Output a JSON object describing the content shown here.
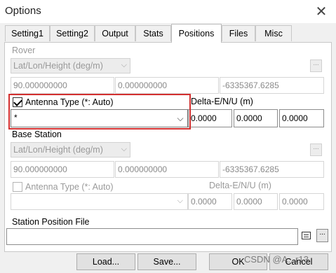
{
  "window": {
    "title": "Options",
    "close_glyph": "✕"
  },
  "tabs": [
    {
      "label": "Setting1"
    },
    {
      "label": "Setting2"
    },
    {
      "label": "Output"
    },
    {
      "label": "Stats"
    },
    {
      "label": "Positions",
      "active": true
    },
    {
      "label": "Files"
    },
    {
      "label": "Misc"
    }
  ],
  "rover": {
    "group_label": "Rover",
    "position_type": "Lat/Lon/Height (deg/m)",
    "lat": "90.000000000",
    "lon": "0.000000000",
    "height": "-6335367.6285",
    "dots_label": "...",
    "antenna_label": "Antenna Type (*: Auto)",
    "antenna_checked": true,
    "antenna_value": "*",
    "delta_label": "Delta-E/N/U (m)",
    "delta_e": "0.0000",
    "delta_n": "0.0000",
    "delta_u": "0.0000"
  },
  "base": {
    "group_label": "Base Station",
    "position_type": "Lat/Lon/Height (deg/m)",
    "lat": "90.000000000",
    "lon": "0.000000000",
    "height": "-6335367.6285",
    "dots_label": "...",
    "antenna_label": "Antenna Type (*: Auto)",
    "antenna_checked": false,
    "antenna_value": "",
    "delta_label": "Delta-E/N/U (m)",
    "delta_e": "0.0000",
    "delta_n": "0.0000",
    "delta_u": "0.0000"
  },
  "station_file": {
    "label": "Station Position File",
    "value": "",
    "dots_label": "..."
  },
  "buttons": {
    "load": "Load...",
    "save": "Save...",
    "ok": "OK",
    "cancel": "Cancel"
  },
  "watermark": "CSDN @A...r13",
  "colors": {
    "highlight": "#d32f2f",
    "active_tab_bg": "#ffffff"
  }
}
